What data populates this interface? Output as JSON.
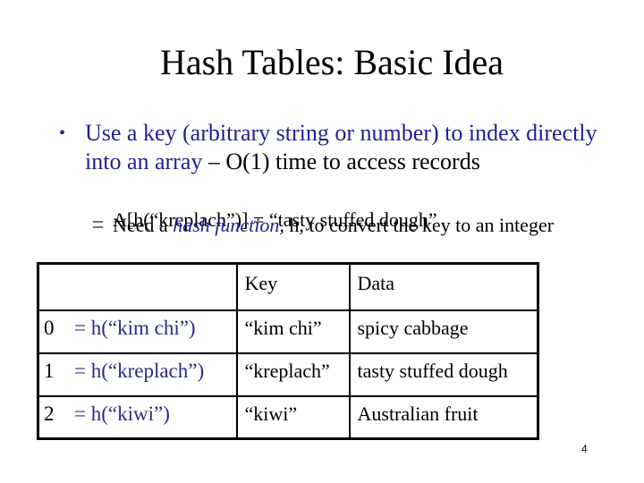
{
  "slide": {
    "title": "Hash Tables: Basic Idea",
    "bullet": {
      "marker": "•",
      "text_blue": "Use a key (arbitrary string or number) to index directly into an array",
      "text_black": " – O(1) time to access records"
    },
    "subbullets": [
      {
        "marker": "–",
        "text": "A[h(“kreplach”)] = “tasty stuffed dough”"
      },
      {
        "marker": "–",
        "prefix": "Need a ",
        "emphasis": "hash function",
        "suffix": ", h, to convert the key to an integer"
      }
    ],
    "colors": {
      "accent_blue": "#1f1f99",
      "text": "#000000",
      "background": "#ffffff"
    },
    "page_number": "4"
  },
  "table": {
    "headers": [
      "",
      "Key",
      "Data"
    ],
    "rows": [
      {
        "index": "0",
        "hash_expr": "= h(“kim chi”)",
        "key": "“kim chi”",
        "data": "spicy cabbage"
      },
      {
        "index": "1",
        "hash_expr": "= h(“kreplach”)",
        "key": "“kreplach”",
        "data": "tasty stuffed dough"
      },
      {
        "index": "2",
        "hash_expr": "= h(“kiwi”)",
        "key": "“kiwi”",
        "data": "Australian fruit"
      }
    ]
  }
}
